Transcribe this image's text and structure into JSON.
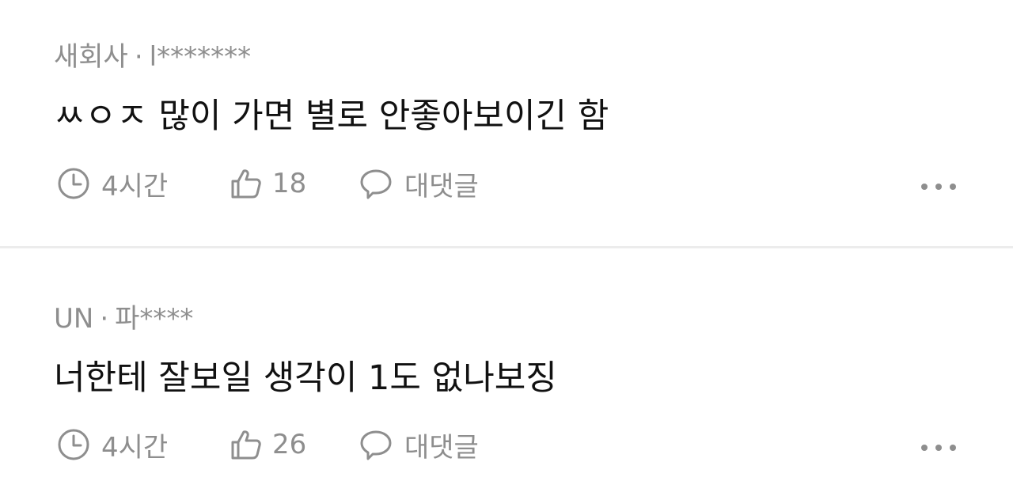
{
  "comments": [
    {
      "company": "새회사",
      "separator": "·",
      "author": "l*******",
      "text": "ㅆㅇㅈ 많이 가면 별로 안좋아보이긴 함",
      "time": "4시간",
      "likes": "18",
      "reply_label": "대댓글"
    },
    {
      "company": "UN",
      "separator": "·",
      "author": "파****",
      "text": "너한테 잘보일 생각이 1도 없나보징",
      "time": "4시간",
      "likes": "26",
      "reply_label": "대댓글"
    }
  ],
  "icons": {
    "time": "clock-icon",
    "like": "thumbs-up-icon",
    "reply": "speech-bubble-icon",
    "more": "more-dots-icon"
  },
  "colors": {
    "text": "#111111",
    "muted": "#8e8e8e",
    "divider": "#ececec"
  }
}
